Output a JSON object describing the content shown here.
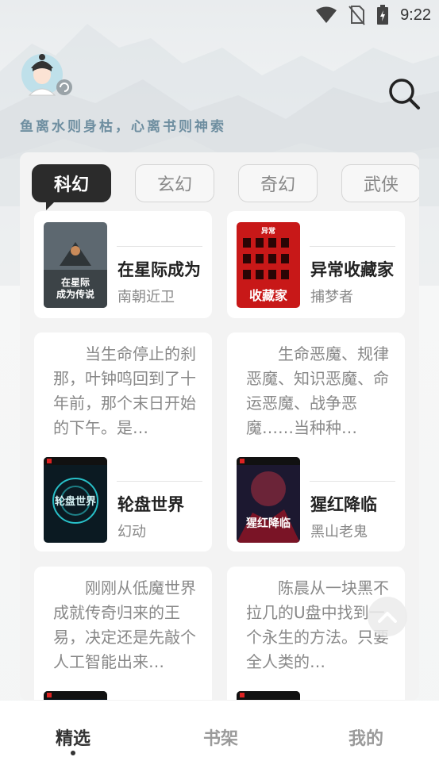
{
  "status_bar": {
    "time": "9:22"
  },
  "header": {
    "motto": "鱼离水则身枯，心离书则神索"
  },
  "tabs": [
    {
      "label": "科幻",
      "active": true
    },
    {
      "label": "玄幻",
      "active": false
    },
    {
      "label": "奇幻",
      "active": false
    },
    {
      "label": "武侠",
      "active": false
    }
  ],
  "books": [
    {
      "title": "在星际成为",
      "author": "南朝近卫",
      "description": "",
      "cover_text": "在星际成为传说"
    },
    {
      "title": "异常收藏家",
      "author": "捕梦者",
      "description": "",
      "cover_text": "异常收藏家"
    },
    {
      "title": "轮盘世界",
      "author": "幻动",
      "description": "当生命停止的刹那，叶钟鸣回到了十年前，那个末日开始的下午。是…",
      "cover_text": "轮盘世界"
    },
    {
      "title": "猩红降临",
      "author": "黑山老鬼",
      "description": "生命恶魔、规律恶魔、知识恶魔、命运恶魔、战争恶魔……当种种…",
      "cover_text": "猩红降临"
    },
    {
      "title": "",
      "author": "",
      "description": "刚刚从低魔世界成就传奇归来的王易，决定还是先敲个人工智能出来…",
      "cover_text": ""
    },
    {
      "title": "",
      "author": "",
      "description": "陈晨从一块黑不拉几的U盘中找到一个永生的方法。只要全人类的…",
      "cover_text": ""
    }
  ],
  "bottom_nav": [
    {
      "label": "精选",
      "active": true
    },
    {
      "label": "书架",
      "active": false
    },
    {
      "label": "我的",
      "active": false
    }
  ],
  "colors": {
    "accent_dark": "#2b2b2b",
    "motto": "#6e8ea0",
    "muted": "#888888"
  }
}
